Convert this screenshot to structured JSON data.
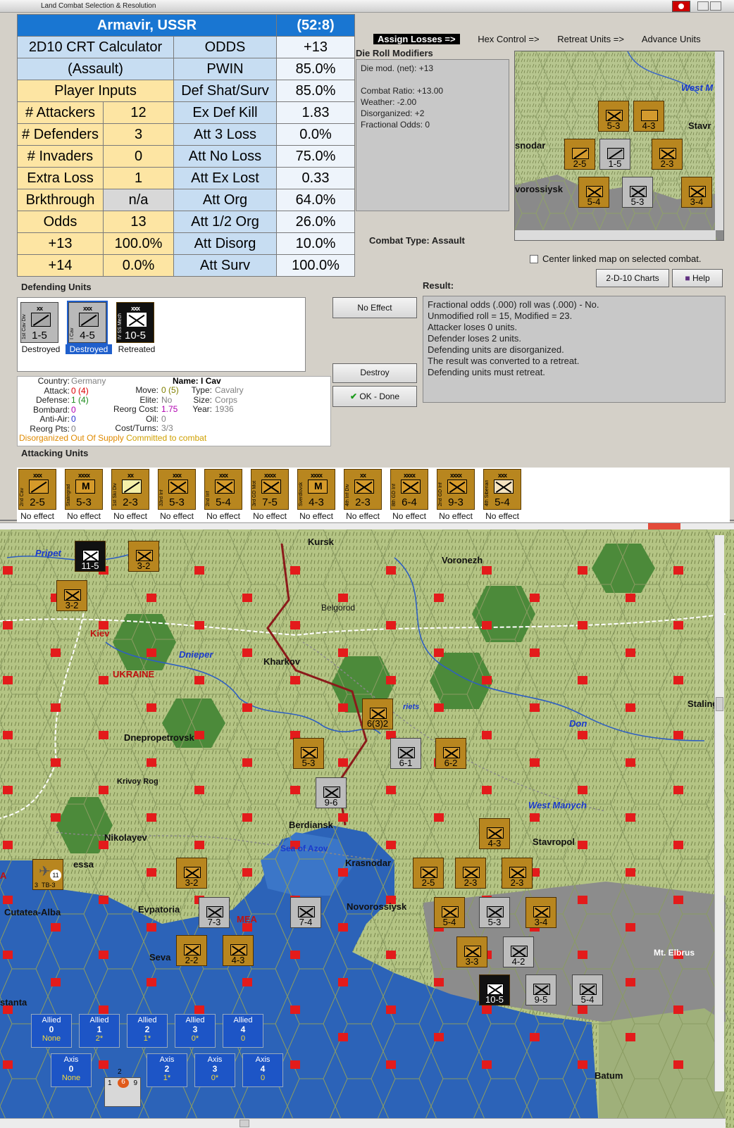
{
  "window": {
    "title": "Land Combat Selection & Resolution"
  },
  "crt": {
    "location": "Armavir, USSR",
    "coords": "(52:8)",
    "title1": "2D10 CRT Calculator",
    "title2": "(Assault)",
    "player_inputs": "Player Inputs",
    "rows_left": [
      {
        "label": "# Attackers",
        "value": "12"
      },
      {
        "label": "# Defenders",
        "value": "3"
      },
      {
        "label": "# Invaders",
        "value": "0"
      },
      {
        "label": "Extra Loss",
        "value": "1"
      },
      {
        "label": "Brkthrough",
        "value": "n/a"
      },
      {
        "label": "Odds",
        "value": "13"
      },
      {
        "label": "+13",
        "value": "100.0%"
      },
      {
        "label": "+14",
        "value": "0.0%"
      }
    ],
    "rows_right": [
      {
        "label": "ODDS",
        "value": "+13"
      },
      {
        "label": "PWIN",
        "value": "85.0%"
      },
      {
        "label": "Def Shat/Surv",
        "value": "85.0%"
      },
      {
        "label": "Ex Def Kill",
        "value": "1.83"
      },
      {
        "label": "Att 3 Loss",
        "value": "0.0%"
      },
      {
        "label": "Att No Loss",
        "value": "75.0%"
      },
      {
        "label": "Att Ex Lost",
        "value": "0.33"
      },
      {
        "label": "Att Org",
        "value": "64.0%"
      },
      {
        "label": "Att 1/2 Org",
        "value": "26.0%"
      },
      {
        "label": "Att Disorg",
        "value": "10.0%"
      },
      {
        "label": "Att Surv",
        "value": "100.0%"
      }
    ]
  },
  "tabs": [
    "Assign Losses =>",
    "Hex Control =>",
    "Retreat Units =>",
    "Advance Units"
  ],
  "die_roll": {
    "title": "Die Roll Modifiers",
    "lines": [
      "Die mod. (net): +13",
      "",
      "Combat Ratio: +13.00",
      "Weather: -2.00",
      "Disorganized: +2",
      "Fractional Odds: 0"
    ]
  },
  "combat_type": "Combat Type:  Assault",
  "center_link": "Center linked map on selected combat.",
  "buttons": {
    "charts": "2-D-10 Charts",
    "help": "Help",
    "no_effect": "No Effect",
    "destroy": "Destroy",
    "ok": "OK - Done"
  },
  "result": {
    "title": "Result:",
    "lines": [
      "Fractional odds (.000) roll was (.000)  - No.",
      "Unmodified roll = 15, Modified = 23.",
      "Attacker loses 0 units.",
      "Defender loses 2 units.",
      "Defending units are disorganized.",
      "The result was converted to a retreat.",
      "Defending units must retreat."
    ]
  },
  "defending": {
    "title": "Defending Units",
    "units": [
      {
        "size": "xx",
        "name": "1st Cav Div",
        "value": "1-5",
        "status": "Destroyed",
        "style": "gray"
      },
      {
        "size": "xxx",
        "name": "I Cav",
        "value": "4-5",
        "status": "Destroyed",
        "style": "gray"
      },
      {
        "size": "xxx",
        "name": "IV SS Mech",
        "value": "10-5",
        "status": "Retreated",
        "style": "black"
      }
    ]
  },
  "info": {
    "country_label": "Country:",
    "country": "Germany",
    "attack_label": "Attack:",
    "attack": "0",
    "attack_b": "(4)",
    "defense_label": "Defense:",
    "defense": "1",
    "defense_b": "(4)",
    "bombard_label": "Bombard:",
    "bombard": "0",
    "antiair_label": "Anti-Air:",
    "antiair": "0",
    "reorg_label": "Reorg Pts:",
    "reorg": "0",
    "name_label": "Name:",
    "name": "I Cav",
    "move_label": "Move:",
    "move": "0",
    "move_b": "(5)",
    "elite_label": "Elite:",
    "elite": "No",
    "reorgcost_label": "Reorg Cost:",
    "reorgcost": "1.75",
    "oil_label": "Oil:",
    "oil": "0",
    "costturns_label": "Cost/Turns:",
    "costturns": "3/3",
    "type_label": "Type:",
    "type": "Cavalry",
    "size_label": "Size:",
    "size": "Corps",
    "year_label": "Year:",
    "year": "1936",
    "status1": "Disorganized",
    "status2": "Out Of Supply",
    "status3": "Committed to combat"
  },
  "attacking": {
    "title": "Attacking Units",
    "units": [
      {
        "size": "xxx",
        "name": "2nd Cav",
        "value": "2-5",
        "status": "No effect",
        "sym": "s"
      },
      {
        "size": "xxxx",
        "name": "Stalingrad",
        "value": "5-3",
        "status": "No effect",
        "sym": "m"
      },
      {
        "size": "xx",
        "name": "1st Ski Div",
        "value": "2-3",
        "status": "No effect",
        "sym": "w"
      },
      {
        "size": "xxx",
        "name": "33rd Inf",
        "value": "5-3",
        "status": "No effect",
        "sym": "x"
      },
      {
        "size": "xxx",
        "name": "2nd Inf",
        "value": "5-4",
        "status": "No effect",
        "sym": "x"
      },
      {
        "size": "xxxx",
        "name": "3rd GD Mot",
        "value": "7-5",
        "status": "No effect",
        "sym": "x"
      },
      {
        "size": "xxxx",
        "name": "Sverdlovsk",
        "value": "4-3",
        "status": "No effect",
        "sym": "m"
      },
      {
        "size": "xx",
        "name": "4th Inf Div",
        "value": "2-3",
        "status": "No effect",
        "sym": "x"
      },
      {
        "size": "xxxx",
        "name": "8th GD Inf",
        "value": "6-4",
        "status": "No effect",
        "sym": "x"
      },
      {
        "size": "xxxx",
        "name": "2nd GD Inf",
        "value": "9-3",
        "status": "No effect",
        "sym": "x"
      },
      {
        "size": "xxx",
        "name": "4th Siberian",
        "value": "5-4",
        "status": "No effect",
        "sym": "xr"
      }
    ]
  },
  "minimap": {
    "labels": [
      "snodar",
      "vorossiysk",
      "Stavr",
      "West M"
    ],
    "units": [
      {
        "value": "5-3"
      },
      {
        "value": "4-3"
      },
      {
        "value": "2-5"
      },
      {
        "value": "1-5"
      },
      {
        "value": "2-3"
      },
      {
        "value": "5-4"
      },
      {
        "value": "5-3"
      },
      {
        "value": "3-4"
      }
    ]
  },
  "map": {
    "cities": [
      "Kursk",
      "Voronezh",
      "Belgorod",
      "Kiev",
      "Kharkov",
      "UKRAINE",
      "Dnepropetrovsk",
      "Krivoy Rog",
      "Berdiansk",
      "Nikolayev",
      "essa",
      "Cutatea-Alba",
      "Evpatoria",
      "MEA",
      "Seva",
      "stanta",
      "Krasnodar",
      "Novorossiysk",
      "Stavropol",
      "Staling",
      "Mt. Elbrus",
      "Batum",
      "A"
    ],
    "waters": [
      "Pripet",
      "Dnieper",
      "Don",
      "West Manych",
      "Sea of Azov",
      "riets"
    ],
    "units": [
      {
        "value": "11-5",
        "style": "black"
      },
      {
        "value": "3-2",
        "style": "brown"
      },
      {
        "value": "3-2",
        "style": "brown"
      },
      {
        "value": "6(3)2",
        "style": "brown"
      },
      {
        "value": "5-3",
        "style": "brown"
      },
      {
        "value": "6-1",
        "style": "gray"
      },
      {
        "value": "6-2",
        "style": "brown"
      },
      {
        "value": "9-6",
        "style": "gray"
      },
      {
        "value": "4-3",
        "style": "brown"
      },
      {
        "value": "2-5",
        "style": "brown"
      },
      {
        "value": "2-3",
        "style": "brown"
      },
      {
        "value": "2-3",
        "style": "brown"
      },
      {
        "value": "5-4",
        "style": "brown"
      },
      {
        "value": "5-3",
        "style": "gray"
      },
      {
        "value": "3-4",
        "style": "brown"
      },
      {
        "value": "3-2",
        "style": "brown"
      },
      {
        "value": "7-3",
        "style": "gray"
      },
      {
        "value": "7-4",
        "style": "gray"
      },
      {
        "value": "2-2",
        "style": "brown"
      },
      {
        "value": "4-3",
        "style": "brown"
      },
      {
        "value": "3-3",
        "style": "brown"
      },
      {
        "value": "4-2",
        "style": "gray"
      },
      {
        "value": "10-5",
        "style": "black"
      },
      {
        "value": "9-5",
        "style": "gray"
      },
      {
        "value": "5-4",
        "style": "gray"
      }
    ],
    "air_unit": {
      "digits": "3",
      "value": "11",
      "code": "TB-3"
    }
  },
  "zones": {
    "allied": [
      {
        "title": "Allied",
        "num": "0",
        "val": "None"
      },
      {
        "title": "Allied",
        "num": "1",
        "val": "2*"
      },
      {
        "title": "Allied",
        "num": "2",
        "val": "1*"
      },
      {
        "title": "Allied",
        "num": "3",
        "val": "0*"
      },
      {
        "title": "Allied",
        "num": "4",
        "val": "0"
      }
    ],
    "axis": [
      {
        "title": "Axis",
        "num": "0",
        "val": "None"
      },
      {
        "title": "Axis",
        "num": "2",
        "val": "1*"
      },
      {
        "title": "Axis",
        "num": "3",
        "val": "0*"
      },
      {
        "title": "Axis",
        "num": "4",
        "val": "0"
      }
    ],
    "pointer": {
      "a": "1",
      "b": "6",
      "c": "9",
      "d": "2"
    }
  }
}
